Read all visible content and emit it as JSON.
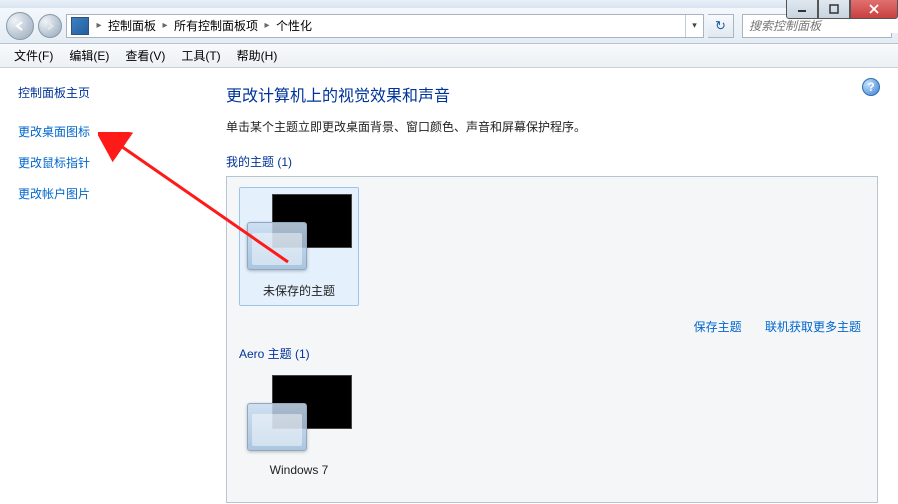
{
  "breadcrumb": {
    "root_icon": "control-panel-icon",
    "items": [
      "控制面板",
      "所有控制面板项",
      "个性化"
    ]
  },
  "search": {
    "placeholder": "搜索控制面板"
  },
  "menubar": [
    "文件(F)",
    "编辑(E)",
    "查看(V)",
    "工具(T)",
    "帮助(H)"
  ],
  "sidebar": {
    "title": "控制面板主页",
    "links": [
      "更改桌面图标",
      "更改鼠标指针",
      "更改帐户图片"
    ]
  },
  "page": {
    "title": "更改计算机上的视觉效果和声音",
    "desc": "单击某个主题立即更改桌面背景、窗口颜色、声音和屏幕保护程序。"
  },
  "groups": {
    "my_themes": {
      "title": "我的主题 (1)",
      "items": [
        {
          "label": "未保存的主题",
          "selected": true
        }
      ]
    },
    "aero_themes": {
      "title": "Aero 主题 (1)",
      "items": [
        {
          "label": "Windows 7",
          "selected": false
        }
      ]
    },
    "actions": {
      "save": "保存主题",
      "more": "联机获取更多主题"
    }
  },
  "help_glyph": "?"
}
